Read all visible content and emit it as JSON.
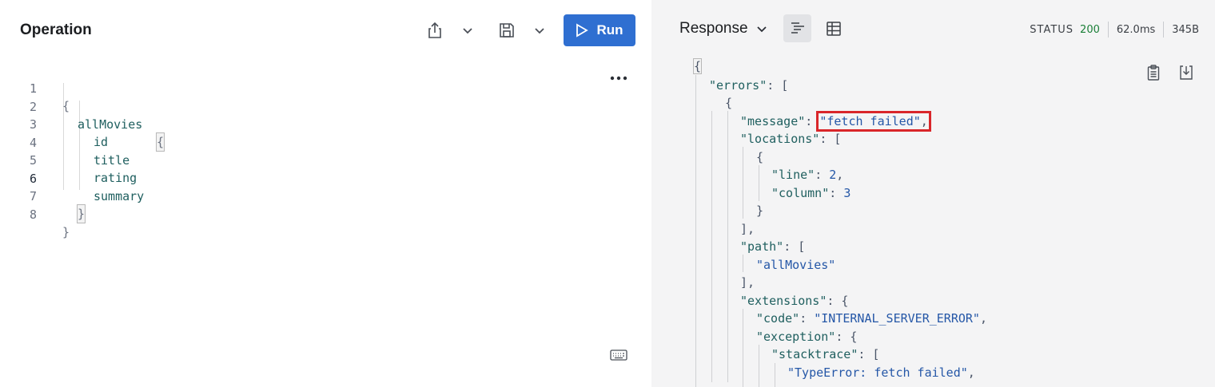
{
  "operation": {
    "title": "Operation",
    "run_label": "Run",
    "lines": [
      {
        "num": "1",
        "text": "{"
      },
      {
        "num": "2",
        "text": "allMovies",
        "open": "{"
      },
      {
        "num": "3",
        "text": "id"
      },
      {
        "num": "4",
        "text": "title"
      },
      {
        "num": "5",
        "text": "rating"
      },
      {
        "num": "6",
        "text": "summary"
      },
      {
        "num": "7",
        "text": "}"
      },
      {
        "num": "8",
        "text": "}"
      }
    ]
  },
  "response": {
    "title": "Response",
    "status_label": "STATUS",
    "status_code": "200",
    "time": "62.0ms",
    "size": "345B",
    "json": {
      "l1": "{",
      "l2_key": "\"errors\"",
      "l2_rest": ": [",
      "l3": "{",
      "l4_key": "\"message\"",
      "l4_sep": ": ",
      "l4_val": "\"fetch failed\"",
      "l4_end": ",",
      "l5_key": "\"locations\"",
      "l5_rest": ": [",
      "l6": "{",
      "l7_key": "\"line\"",
      "l7_sep": ": ",
      "l7_val": "2",
      "l7_end": ",",
      "l8_key": "\"column\"",
      "l8_sep": ": ",
      "l8_val": "3",
      "l9": "}",
      "l10": "],",
      "l11_key": "\"path\"",
      "l11_rest": ": [",
      "l12_val": "\"allMovies\"",
      "l13": "],",
      "l14_key": "\"extensions\"",
      "l14_rest": ": {",
      "l15_key": "\"code\"",
      "l15_sep": ": ",
      "l15_val": "\"INTERNAL_SERVER_ERROR\"",
      "l15_end": ",",
      "l16_key": "\"exception\"",
      "l16_rest": ": {",
      "l17_key": "\"stacktrace\"",
      "l17_rest": ": [",
      "l18_val": "\"TypeError: fetch failed\"",
      "l18_end": ","
    }
  },
  "icons": {
    "share": "share-icon",
    "save": "save-icon",
    "run": "play-icon",
    "more": "more-icon",
    "keyboard": "keyboard-icon",
    "text_view": "text-view-icon",
    "table_view": "table-view-icon",
    "copy": "clipboard-icon",
    "download": "download-icon"
  },
  "colors": {
    "run_button": "#2f6fd1",
    "highlight_border": "#d9262a",
    "status_ok": "#1a7f37"
  }
}
